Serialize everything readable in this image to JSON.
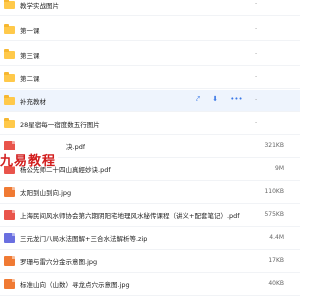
{
  "rows": [
    {
      "name": "教学实战图片",
      "type": "folder",
      "size": "-"
    },
    {
      "name": "第一课",
      "type": "folder",
      "size": "-"
    },
    {
      "name": "第三课",
      "type": "folder",
      "size": "-"
    },
    {
      "name": "第二课",
      "type": "folder",
      "size": "-"
    },
    {
      "name": "补充教材",
      "type": "folder",
      "size": "-"
    },
    {
      "name": "28星宿每一宿度数五行图片",
      "type": "folder",
      "size": "-"
    },
    {
      "name": "决.pdf",
      "type": "pdf",
      "size": "321KB"
    },
    {
      "name": "杨公先师二十四山真經妙诀.pdf",
      "type": "pdf",
      "size": "9M"
    },
    {
      "name": "太阳到山到向.jpg",
      "type": "img",
      "size": "110KB"
    },
    {
      "name": "上海民间风水师协会第六期阴阳宅地理风水秘传课程（讲义+配套笔记）.pdf",
      "type": "pdf",
      "size": "575KB"
    },
    {
      "name": "三元龙门八局水法图解+三合水法解析等.zip",
      "type": "zip",
      "size": "4.4M"
    },
    {
      "name": "罗珊与雷穴分金示意图.jpg",
      "type": "img",
      "size": "17KB"
    },
    {
      "name": "标准山向（山数）寻龙点穴示意图.jpg",
      "type": "img",
      "size": "40KB"
    }
  ],
  "hovered_actions": {
    "share": "⤤",
    "download": "⬇",
    "more": "•••"
  },
  "watermark": "九易教程"
}
